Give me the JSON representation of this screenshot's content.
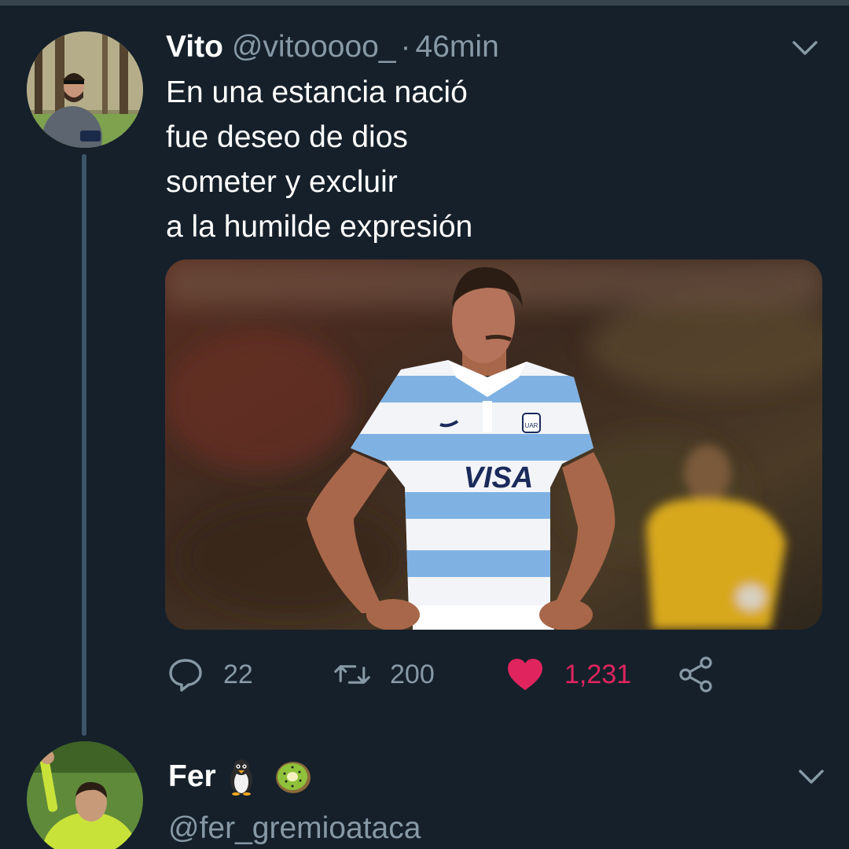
{
  "tweet": {
    "author_name": "Vito",
    "author_handle": "@vitooooo_",
    "separator": "·",
    "time": "46min",
    "text_lines": [
      "En una estancia nació",
      "fue deseo de dios",
      "someter y excluir",
      "a la humilde expresión"
    ],
    "media": {
      "jersey_sponsor": "VISA",
      "jersey_badge": "UAR"
    },
    "actions": {
      "reply_count": "22",
      "retweet_count": "200",
      "like_count": "1,231"
    }
  },
  "reply": {
    "author_name": "Fer",
    "author_handle": "@fer_gremioataca",
    "emojis": [
      "penguin-icon",
      "kiwi-icon"
    ]
  },
  "colors": {
    "background": "#15202b",
    "secondary_text": "#8899a6",
    "like": "#e0245e",
    "thread_line": "#3d5466"
  }
}
